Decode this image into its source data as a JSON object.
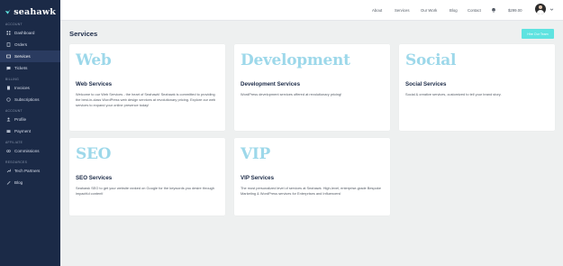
{
  "brand": {
    "name": "seahawk"
  },
  "sidebar": {
    "sections": [
      {
        "label": "Account",
        "items": [
          {
            "label": "Dashboard",
            "icon": "dashboard-icon"
          },
          {
            "label": "Orders",
            "icon": "orders-icon"
          },
          {
            "label": "Services",
            "icon": "services-icon",
            "active": true
          },
          {
            "label": "Tickets",
            "icon": "tickets-icon"
          }
        ]
      },
      {
        "label": "Billing",
        "items": [
          {
            "label": "Invoices",
            "icon": "invoice-icon"
          },
          {
            "label": "Subscriptions",
            "icon": "subscriptions-icon"
          }
        ]
      },
      {
        "label": "Account",
        "items": [
          {
            "label": "Profile",
            "icon": "profile-icon"
          },
          {
            "label": "Payment",
            "icon": "payment-icon"
          }
        ]
      },
      {
        "label": "Affiliate",
        "items": [
          {
            "label": "Commissions",
            "icon": "commissions-icon"
          }
        ]
      },
      {
        "label": "Resources",
        "items": [
          {
            "label": "Tech Partners",
            "icon": "wrench-icon"
          },
          {
            "label": "Blog",
            "icon": "pen-icon"
          }
        ]
      }
    ]
  },
  "topbar": {
    "links": [
      "About",
      "Services",
      "Our Work",
      "Blog",
      "Contact"
    ],
    "price": "$299.00",
    "bell_icon": "bell-icon",
    "avatar": "user-avatar"
  },
  "page": {
    "title": "Services",
    "cta_label": "Hire Our Team"
  },
  "colors": {
    "sidebar": "#1b2a47",
    "accent": "#5fe3e0",
    "card_word": "#9dd8ea"
  },
  "cards": [
    {
      "big_word": "Web",
      "title": "Web Services",
      "desc": "Welcome to our Web Services - the heart of Seahawk! Seahawk is committed to providing the best-in-class WordPress web design services at revolutionary pricing. Explore our web services to expand your online presence today!"
    },
    {
      "big_word": "Development",
      "title": "Development Services",
      "desc": "WordPress development services offered at revolutionary pricing!"
    },
    {
      "big_word": "Social",
      "title": "Social Services",
      "desc": "Social & creative services, customized to tell your brand story."
    },
    {
      "big_word": "SEO",
      "title": "SEO Services",
      "desc": "Seahawk SEO to get your website ranked on Google for the keywords you desire through impactful content!"
    },
    {
      "big_word": "VIP",
      "title": "VIP Services",
      "desc": "The most personalized level of services at Seahawk. High-level, enterprise-grade Bespoke Marketing & WordPress services for Enterprises and Influencers!"
    }
  ]
}
